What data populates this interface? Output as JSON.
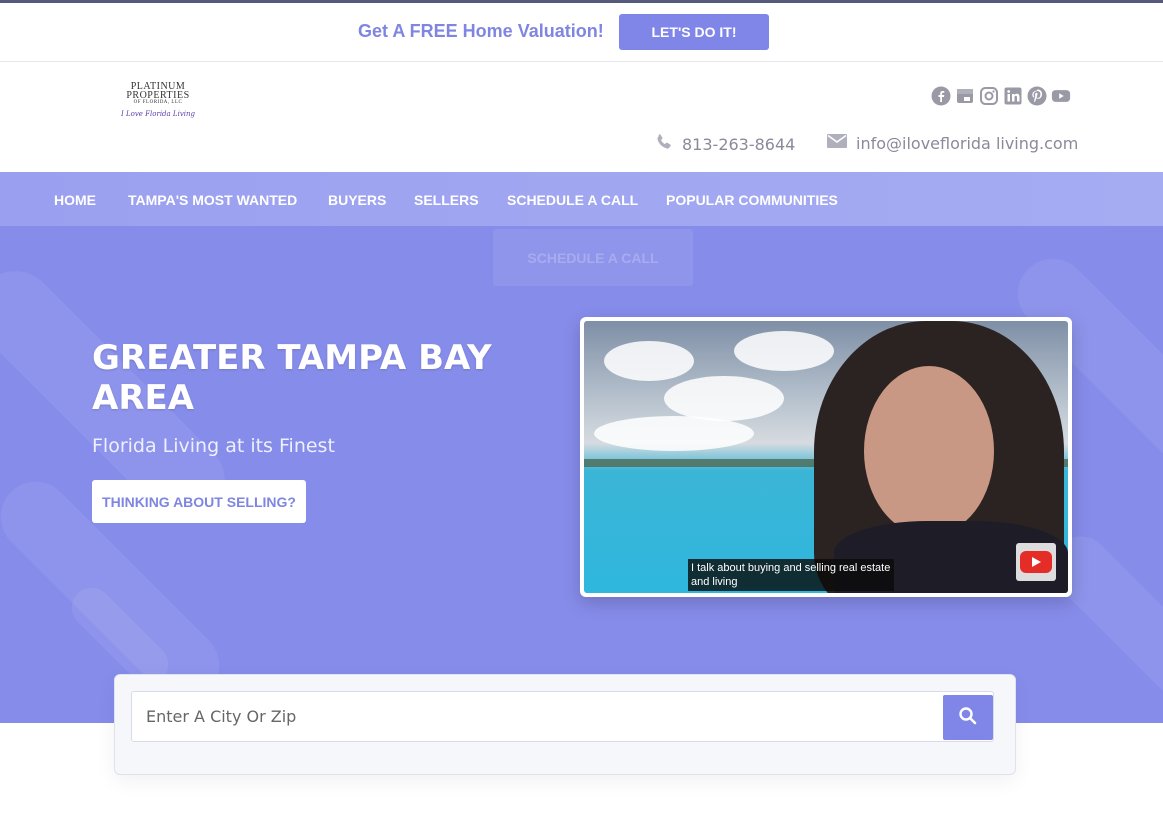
{
  "promo": {
    "text": "Get A FREE Home Valuation!",
    "button": "LET'S DO IT!"
  },
  "logo": {
    "line1": "PLATINUM",
    "line2": "PROPERTIES",
    "line3": "OF FLORIDA, LLC",
    "signature": "I Love Florida Living"
  },
  "social": [
    "facebook-icon",
    "google-business-icon",
    "instagram-icon",
    "linkedin-icon",
    "pinterest-icon",
    "youtube-icon"
  ],
  "contact": {
    "phone": "813-263-8644",
    "email": "info@iloveflorida living.com"
  },
  "nav": {
    "items": [
      "HOME",
      "TAMPA'S MOST WANTED",
      "BUYERS",
      "SELLERS",
      "SCHEDULE A CALL",
      "POPULAR COMMUNITIES"
    ],
    "dropdown_ghost": "SCHEDULE A CALL"
  },
  "hero": {
    "title": "GREATER TAMPA BAY AREA",
    "subtitle": "Florida Living at its Finest",
    "button": "THINKING ABOUT SELLING?"
  },
  "video": {
    "caption": "I talk about buying and selling real estate and living"
  },
  "search": {
    "placeholder": "Enter A City Or Zip"
  },
  "colors": {
    "accent": "#7f86e8",
    "hero_bg": "#868cea",
    "nav_bg": "#a0a6f0"
  }
}
